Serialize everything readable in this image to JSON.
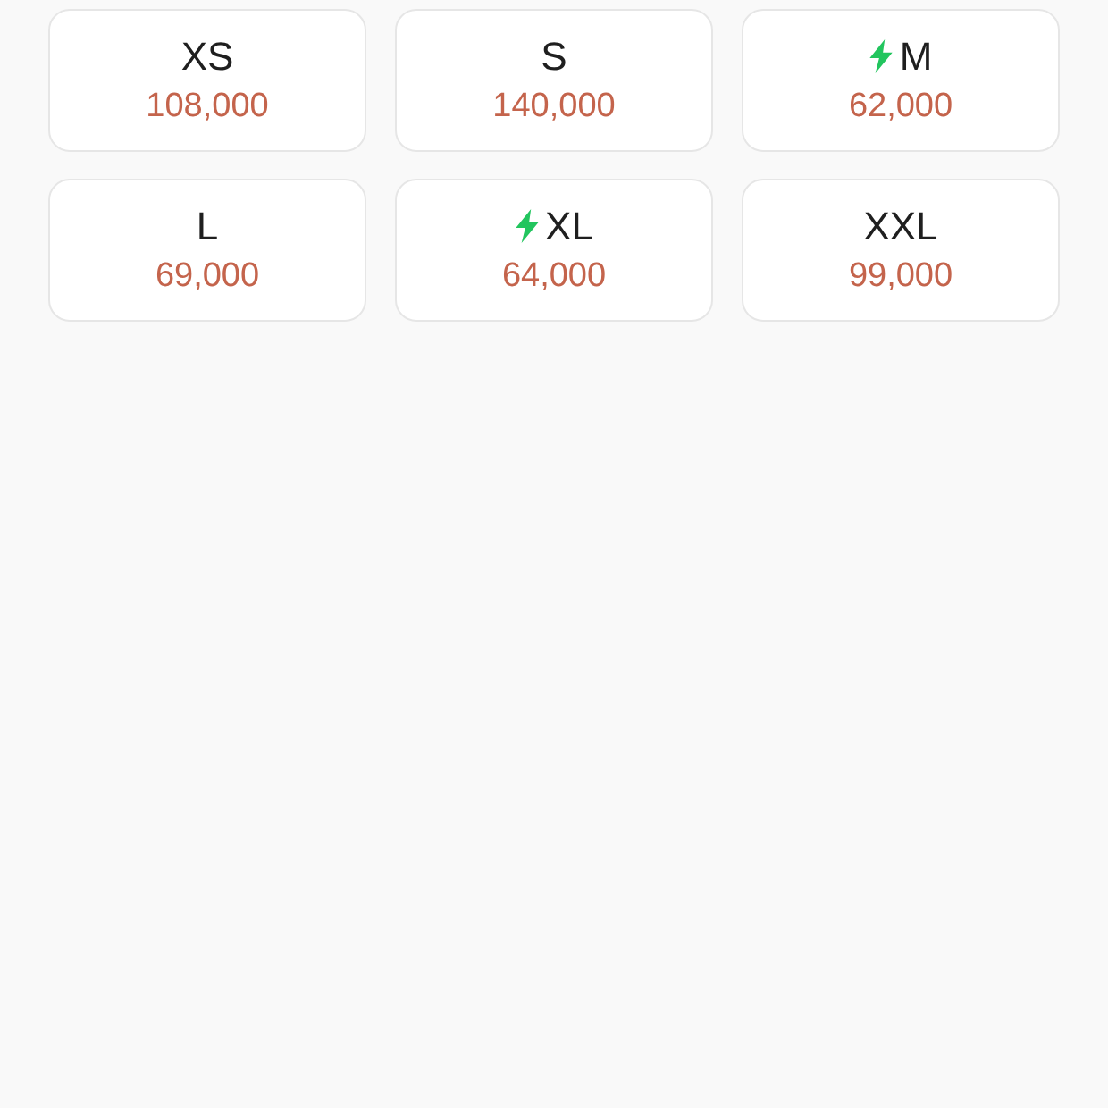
{
  "sizes": [
    {
      "label": "XS",
      "price": "108,000",
      "fast": false
    },
    {
      "label": "S",
      "price": "140,000",
      "fast": false
    },
    {
      "label": "M",
      "price": "62,000",
      "fast": true
    },
    {
      "label": "L",
      "price": "69,000",
      "fast": false
    },
    {
      "label": "XL",
      "price": "64,000",
      "fast": true
    },
    {
      "label": "XXL",
      "price": "99,000",
      "fast": false
    }
  ]
}
